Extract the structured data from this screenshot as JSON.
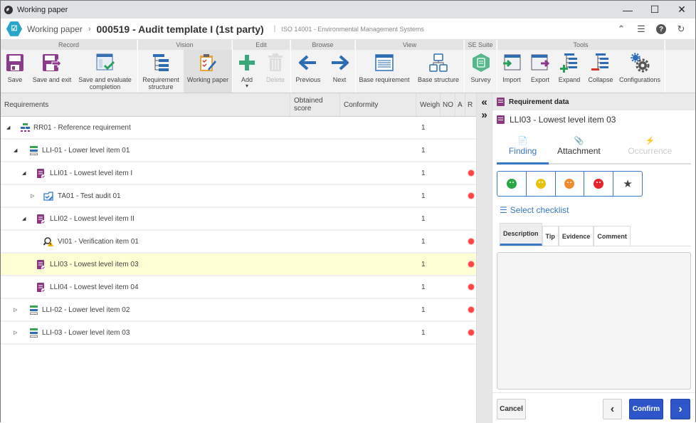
{
  "window": {
    "title": "Working paper",
    "minimize": "—",
    "maximize": "☐",
    "close": "✕"
  },
  "header": {
    "logo_glyph": "☑",
    "breadcrumb_root": "Working paper",
    "separator": "›",
    "title": "000519 - Audit template I (1st party)",
    "pipe": "|",
    "standard": "ISO 14001 - Environmental Management Systems",
    "icons": {
      "collapse": "⌃",
      "list": "☰",
      "help": "?",
      "refresh": "↻"
    }
  },
  "ribbon": {
    "groups": [
      {
        "title": "Record",
        "buttons": [
          {
            "label": "Save",
            "icon": "save-icon"
          },
          {
            "label": "Save and exit",
            "icon": "save-exit-icon"
          },
          {
            "label": "Save and evaluate completion",
            "icon": "evaluate-icon"
          }
        ]
      },
      {
        "title": "Vision",
        "buttons": [
          {
            "label": "Requirement structure",
            "icon": "structure-icon"
          },
          {
            "label": "Working paper",
            "icon": "working-paper-icon",
            "active": true
          }
        ]
      },
      {
        "title": "Edit",
        "buttons": [
          {
            "label": "Add",
            "icon": "add-icon",
            "dropdown": "▾"
          },
          {
            "label": "Delete",
            "icon": "delete-icon",
            "disabled": true
          }
        ]
      },
      {
        "title": "Browse",
        "buttons": [
          {
            "label": "Previous",
            "icon": "arrow-left-icon"
          },
          {
            "label": "Next",
            "icon": "arrow-right-icon"
          }
        ]
      },
      {
        "title": "View",
        "buttons": [
          {
            "label": "Base requirement",
            "icon": "base-requirement-icon"
          },
          {
            "label": "Base structure",
            "icon": "base-structure-icon"
          }
        ]
      },
      {
        "title": "SE Suite",
        "buttons": [
          {
            "label": "Survey",
            "icon": "survey-icon"
          }
        ]
      },
      {
        "title": "Tools",
        "buttons": [
          {
            "label": "Import",
            "icon": "import-icon"
          },
          {
            "label": "Export",
            "icon": "export-icon"
          },
          {
            "label": "Expand",
            "icon": "expand-icon"
          },
          {
            "label": "Collapse",
            "icon": "collapse-icon"
          },
          {
            "label": "Configurations",
            "icon": "gears-icon"
          }
        ]
      }
    ]
  },
  "grid": {
    "columns": [
      "Requirements",
      "Obtained score",
      "Conformity",
      "Weight",
      "NO",
      "A",
      "R"
    ],
    "rows": [
      {
        "label": "RR01 - Reference requirement",
        "weight": "1",
        "level": 0,
        "expander": "◢",
        "type": "reference",
        "flag": false
      },
      {
        "label": "LLI-01 - Lower level item 01",
        "weight": "1",
        "level": 1,
        "expander": "◢",
        "type": "lower",
        "flag": false
      },
      {
        "label": "LLI01 - Lowest level item I",
        "weight": "1",
        "level": 2,
        "expander": "◢",
        "type": "lowest",
        "flag": true
      },
      {
        "label": "TA01 - Test audit 01",
        "weight": "1",
        "level": 3,
        "expander": "▷",
        "type": "audit",
        "flag": true
      },
      {
        "label": "LLI02 - Lowest level item II",
        "weight": "1",
        "level": 2,
        "expander": "◢",
        "type": "lowest",
        "flag": false
      },
      {
        "label": "VI01 - Verification item 01",
        "weight": "1",
        "level": 3,
        "expander": "",
        "type": "verification",
        "flag": true
      },
      {
        "label": "LLI03 - Lowest level item 03",
        "weight": "1",
        "level": 2,
        "expander": "",
        "type": "lowest",
        "flag": true,
        "selected": true
      },
      {
        "label": "LLI04 - Lowest level item 04",
        "weight": "1",
        "level": 2,
        "expander": "",
        "type": "lowest",
        "flag": true
      },
      {
        "label": "LLI-02 - Lower level item 02",
        "weight": "1",
        "level": 1,
        "expander": "▷",
        "type": "lower",
        "flag": true
      },
      {
        "label": "LLI-03 - Lower level item 03",
        "weight": "1",
        "level": 1,
        "expander": "▷",
        "type": "lower",
        "flag": true
      }
    ]
  },
  "splitter": {
    "collapse_left": "«",
    "expand_right": "»"
  },
  "panel": {
    "header": "Requirement data",
    "item_title": "LLI03 - Lowest level item 03",
    "tabs": [
      {
        "label": "Finding",
        "icon": "📄",
        "active": true
      },
      {
        "label": "Attachment",
        "icon": "📎"
      },
      {
        "label": "Occurrence",
        "icon": "⚡",
        "disabled": true
      }
    ],
    "ratings": [
      {
        "name": "very-satisfied",
        "color": "#27a844"
      },
      {
        "name": "neutral",
        "color": "#e8c20e"
      },
      {
        "name": "dissatisfied",
        "color": "#f08a2a"
      },
      {
        "name": "very-dissatisfied",
        "color": "#e8252d"
      },
      {
        "name": "star",
        "color": "#444",
        "glyph": "★"
      }
    ],
    "select_checklist": "Select checklist",
    "checklist_icon": "☰",
    "detail_tabs": [
      "Description",
      "Tip",
      "Evidence",
      "Comment"
    ],
    "description_value": "",
    "buttons": {
      "cancel": "Cancel",
      "prev": "‹",
      "confirm": "Confirm",
      "next": "›"
    }
  },
  "colors": {
    "accent": "#3a78c3",
    "confirm": "#2e55c9",
    "selected_row": "#fefed5",
    "flag": "#f44444",
    "requirement_icon": "#8b3a7f"
  }
}
